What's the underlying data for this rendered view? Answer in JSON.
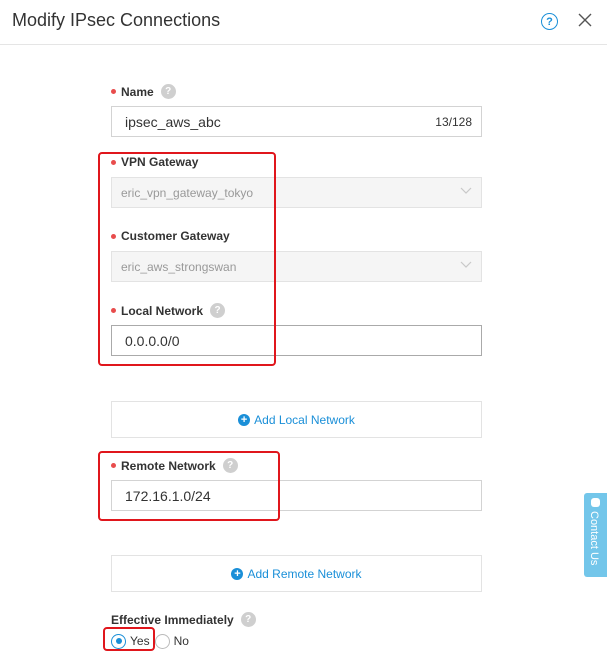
{
  "dialog": {
    "title": "Modify IPsec Connections",
    "help_glyph": "?"
  },
  "fields": {
    "name": {
      "label": "Name",
      "value": "ipsec_aws_abc",
      "counter": "13/128"
    },
    "vpn_gateway": {
      "label": "VPN Gateway",
      "value": "eric_vpn_gateway_tokyo"
    },
    "customer_gateway": {
      "label": "Customer Gateway",
      "value": "eric_aws_strongswan"
    },
    "local_network": {
      "label": "Local Network",
      "value": "0.0.0.0/0",
      "add_label": "Add Local Network"
    },
    "remote_network": {
      "label": "Remote Network",
      "value": "172.16.1.0/24",
      "add_label": "Add Remote Network"
    },
    "effective_immediately": {
      "label": "Effective Immediately",
      "options": [
        {
          "label": "Yes",
          "checked": true
        },
        {
          "label": "No",
          "checked": false
        }
      ]
    }
  },
  "contact_tab": {
    "label": "Contact Us"
  },
  "colors": {
    "accent": "#1a8fd8",
    "annotation_red": "#e0161c",
    "required_dot": "#e84c4c",
    "contact_tab": "#73c6ea"
  }
}
